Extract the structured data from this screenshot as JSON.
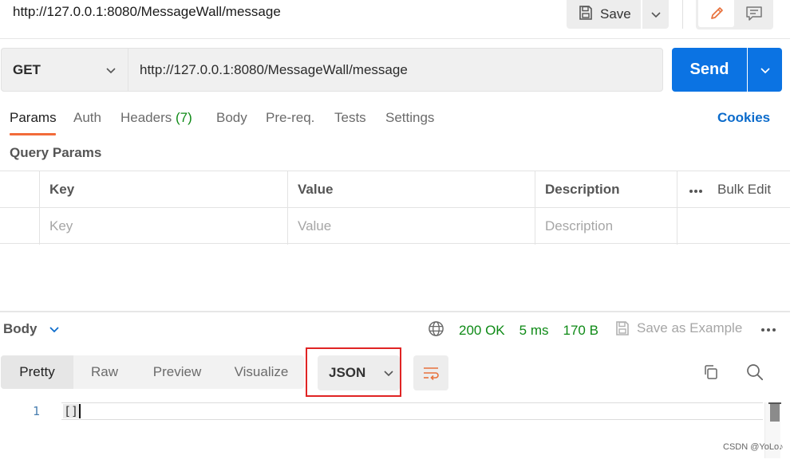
{
  "header": {
    "request_url_title": "http://127.0.0.1:8080/MessageWall/message",
    "save_label": "Save"
  },
  "request": {
    "method": "GET",
    "url": "http://127.0.0.1:8080/MessageWall/message",
    "send_label": "Send"
  },
  "request_tabs": {
    "params": "Params",
    "auth": "Auth",
    "headers": "Headers",
    "headers_count": "(7)",
    "body": "Body",
    "prereq": "Pre-req.",
    "tests": "Tests",
    "settings": "Settings",
    "active": "Params"
  },
  "cookies_label": "Cookies",
  "query_params": {
    "title": "Query Params",
    "columns": {
      "key": "Key",
      "value": "Value",
      "description": "Description"
    },
    "bulk_edit": "Bulk Edit",
    "placeholders": {
      "key": "Key",
      "value": "Value",
      "description": "Description"
    }
  },
  "response": {
    "body_label": "Body",
    "status": "200 OK",
    "time": "5 ms",
    "size": "170 B",
    "save_example": "Save as Example",
    "view_tabs": [
      "Pretty",
      "Raw",
      "Preview",
      "Visualize"
    ],
    "active_view": "Pretty",
    "format": "JSON",
    "line_number": "1",
    "content": "[]"
  },
  "watermark": "CSDN @YoLo♪",
  "colors": {
    "send_blue": "#0b73e3",
    "active_tab_underline": "#f26b3a",
    "status_green": "#0e8a16",
    "highlight_red": "#e02424",
    "cookies_blue": "#0b6bcb"
  },
  "icons": [
    "save-icon",
    "chevron-down-icon",
    "pencil-icon",
    "comment-icon",
    "globe-icon",
    "more-icon",
    "wrap-lines-icon",
    "copy-icon",
    "search-icon"
  ]
}
